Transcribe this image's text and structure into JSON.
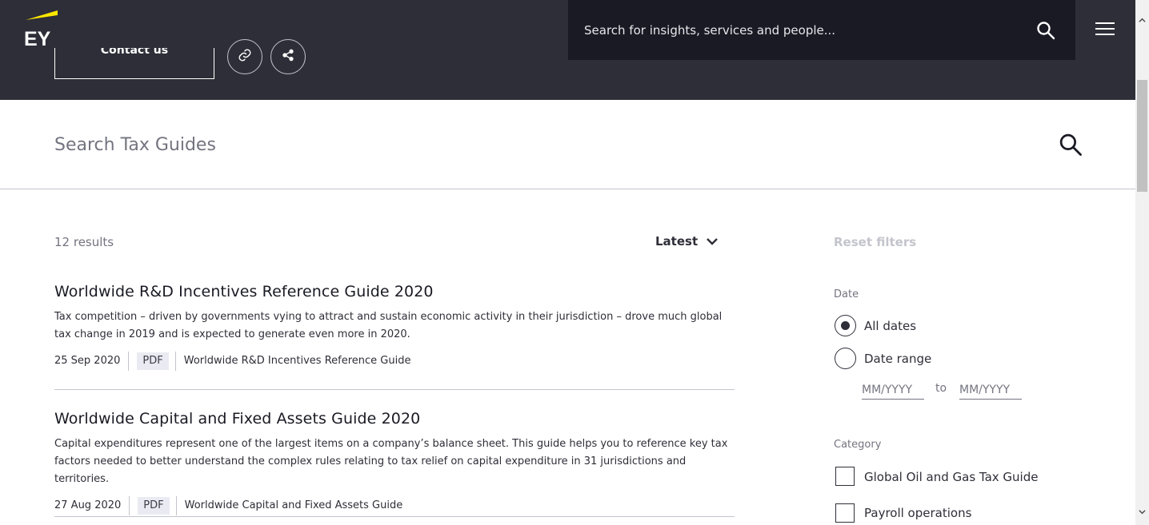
{
  "header": {
    "brand": "EY",
    "contact_label": "Contact us",
    "search_placeholder": "Search for insights, services and people..."
  },
  "guide_search": {
    "placeholder": "Search Tax Guides"
  },
  "results": {
    "count_text": "12 results",
    "sort_label": "Latest",
    "items": [
      {
        "title": "Worldwide R&D Incentives Reference Guide 2020",
        "description": "Tax competition – driven by governments vying to attract and sustain economic activity in their jurisdiction – drove much global tax change in 2019 and is expected to generate even more in 2020.",
        "date": "25 Sep 2020",
        "type": "PDF",
        "source": "Worldwide R&D Incentives Reference Guide"
      },
      {
        "title": "Worldwide Capital and Fixed Assets Guide 2020",
        "description": "Capital expenditures represent one of the largest items on a company’s balance sheet. This guide helps you to reference key tax factors needed to better understand the complex rules relating to tax relief on capital expenditure in 31 jurisdictions and territories.",
        "date": "27 Aug 2020",
        "type": "PDF",
        "source": "Worldwide Capital and Fixed Assets Guide"
      }
    ]
  },
  "filters": {
    "reset_label": "Reset filters",
    "date": {
      "label": "Date",
      "options": [
        {
          "label": "All dates",
          "selected": true
        },
        {
          "label": "Date range",
          "selected": false
        }
      ],
      "from_placeholder": "MM/YYYY",
      "to_label": "to",
      "to_placeholder": "MM/YYYY"
    },
    "category": {
      "label": "Category",
      "options": [
        {
          "label": "Global Oil and Gas Tax Guide",
          "checked": false
        },
        {
          "label": "Payroll operations",
          "checked": false
        }
      ]
    }
  },
  "colors": {
    "header_bg": "#2e2e38",
    "search_bg": "#1a1a24",
    "brand_yellow": "#ffe600"
  }
}
